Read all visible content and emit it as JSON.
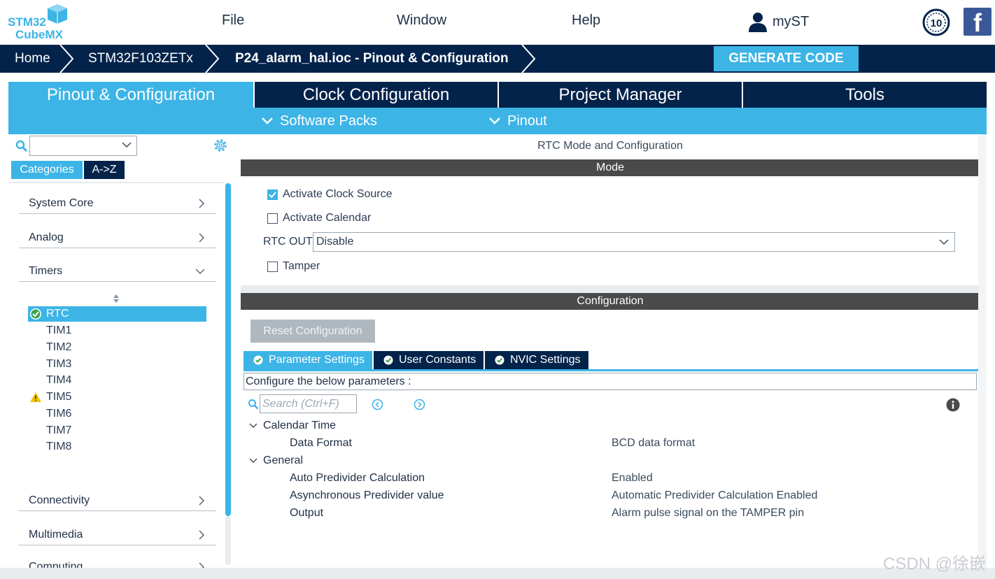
{
  "menubar": {
    "logo_top": "STM32",
    "logo_bottom": "CubeMX",
    "items": [
      "File",
      "Window",
      "Help"
    ],
    "account": "myST",
    "badge_text": "10"
  },
  "breadcrumb": {
    "items": [
      "Home",
      "STM32F103ZETx",
      "P24_alarm_hal.ioc - Pinout & Configuration"
    ],
    "generate_label": "GENERATE CODE"
  },
  "main_tabs": [
    "Pinout & Configuration",
    "Clock Configuration",
    "Project Manager",
    "Tools"
  ],
  "subbar": [
    "Software Packs",
    "Pinout"
  ],
  "left_panel": {
    "search_value": "",
    "tabs": [
      "Categories",
      "A->Z"
    ],
    "categories": [
      "System Core",
      "Analog",
      "Timers",
      "Connectivity",
      "Multimedia",
      "Computing"
    ],
    "timers": [
      {
        "label": "RTC",
        "status": "ok",
        "selected": true
      },
      {
        "label": "TIM1",
        "status": "",
        "selected": false
      },
      {
        "label": "TIM2",
        "status": "",
        "selected": false
      },
      {
        "label": "TIM3",
        "status": "",
        "selected": false
      },
      {
        "label": "TIM4",
        "status": "",
        "selected": false
      },
      {
        "label": "TIM5",
        "status": "warning",
        "selected": false
      },
      {
        "label": "TIM6",
        "status": "",
        "selected": false
      },
      {
        "label": "TIM7",
        "status": "",
        "selected": false
      },
      {
        "label": "TIM8",
        "status": "",
        "selected": false
      }
    ]
  },
  "right_panel": {
    "title": "RTC Mode and Configuration",
    "mode_header": "Mode",
    "mode": {
      "activate_clock_source": {
        "label": "Activate Clock Source",
        "checked": true
      },
      "activate_calendar": {
        "label": "Activate Calendar",
        "checked": false
      },
      "rtc_out_label": "RTC OUT",
      "rtc_out_value": "Disable",
      "tamper": {
        "label": "Tamper",
        "checked": false
      }
    },
    "config_header": "Configuration",
    "reset_label": "Reset Configuration",
    "config_tabs": [
      "Parameter Settings",
      "User Constants",
      "NVIC Settings"
    ],
    "config_desc": "Configure the below parameters :",
    "search_placeholder": "Search (Ctrl+F)",
    "groups": [
      {
        "name": "Calendar Time",
        "params": [
          {
            "name": "Data Format",
            "value": "BCD data format"
          }
        ]
      },
      {
        "name": "General",
        "params": [
          {
            "name": "Auto Predivider Calculation",
            "value": "Enabled"
          },
          {
            "name": "Asynchronous Predivider value",
            "value": "Automatic Predivider Calculation Enabled"
          },
          {
            "name": "Output",
            "value": "Alarm pulse signal on the TAMPER pin"
          }
        ]
      }
    ]
  },
  "watermark": "CSDN @徐嵌",
  "colors": {
    "navy": "#03234b",
    "accent": "#3cb4e6",
    "section": "#4a4a4a"
  }
}
